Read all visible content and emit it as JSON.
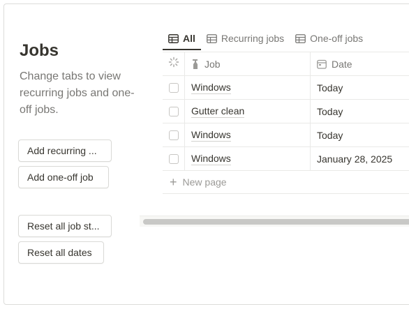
{
  "sidebar": {
    "title": "Jobs",
    "description": "Change tabs to view recurring jobs and one-off jobs.",
    "buttons": {
      "add_recurring": "Add recurring ...",
      "add_one_off": "Add one-off job",
      "reset_status": "Reset all job st...",
      "reset_dates": "Reset all dates"
    }
  },
  "tabs": [
    {
      "label": "All",
      "icon": "table-icon",
      "active": true
    },
    {
      "label": "Recurring jobs",
      "icon": "table-icon",
      "active": false
    },
    {
      "label": "One-off jobs",
      "icon": "table-icon",
      "active": false
    }
  ],
  "table": {
    "columns": {
      "status_icon": "loading-icon",
      "job": "Job",
      "job_icon": "spray-bottle-icon",
      "date": "Date",
      "date_icon": "calendar-icon"
    },
    "rows": [
      {
        "job": "Windows",
        "date": "Today"
      },
      {
        "job": "Gutter clean",
        "date": "Today"
      },
      {
        "job": "Windows",
        "date": "Today"
      },
      {
        "job": "Windows",
        "date": "January 28, 2025"
      }
    ],
    "new_page_label": "New page"
  },
  "colors": {
    "text": "#37352f",
    "muted": "#787774",
    "border": "#e9e9e7"
  }
}
